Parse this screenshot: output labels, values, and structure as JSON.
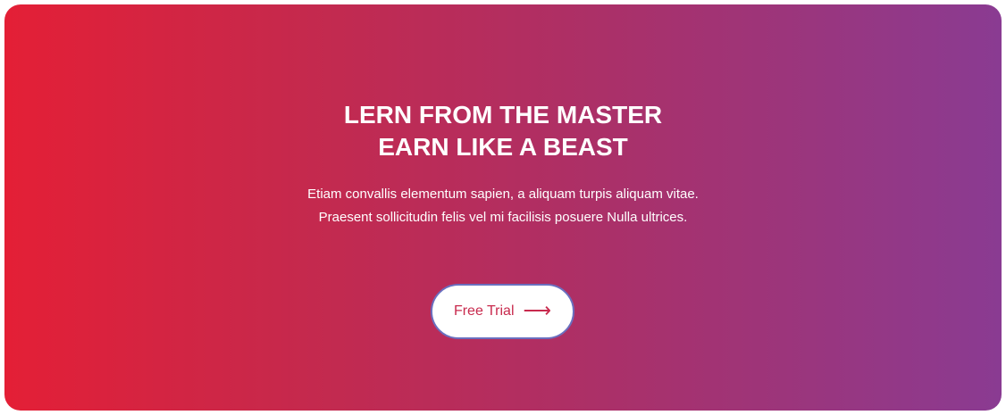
{
  "hero": {
    "headline_line1": "LERN FROM THE MASTER",
    "headline_line2": "EARN LIKE A BEAST",
    "description_line1": "Etiam convallis elementum sapien, a aliquam turpis aliquam vitae.",
    "description_line2": "Praesent sollicitudin felis vel mi facilisis posuere Nulla ultrices.",
    "cta_label": "Free Trial",
    "cta_icon": "arrow-right-icon"
  },
  "colors": {
    "gradient_start": "#e41f36",
    "gradient_end": "#8a3b92",
    "button_text": "#c82a4d",
    "button_border": "#6a6fbf"
  }
}
